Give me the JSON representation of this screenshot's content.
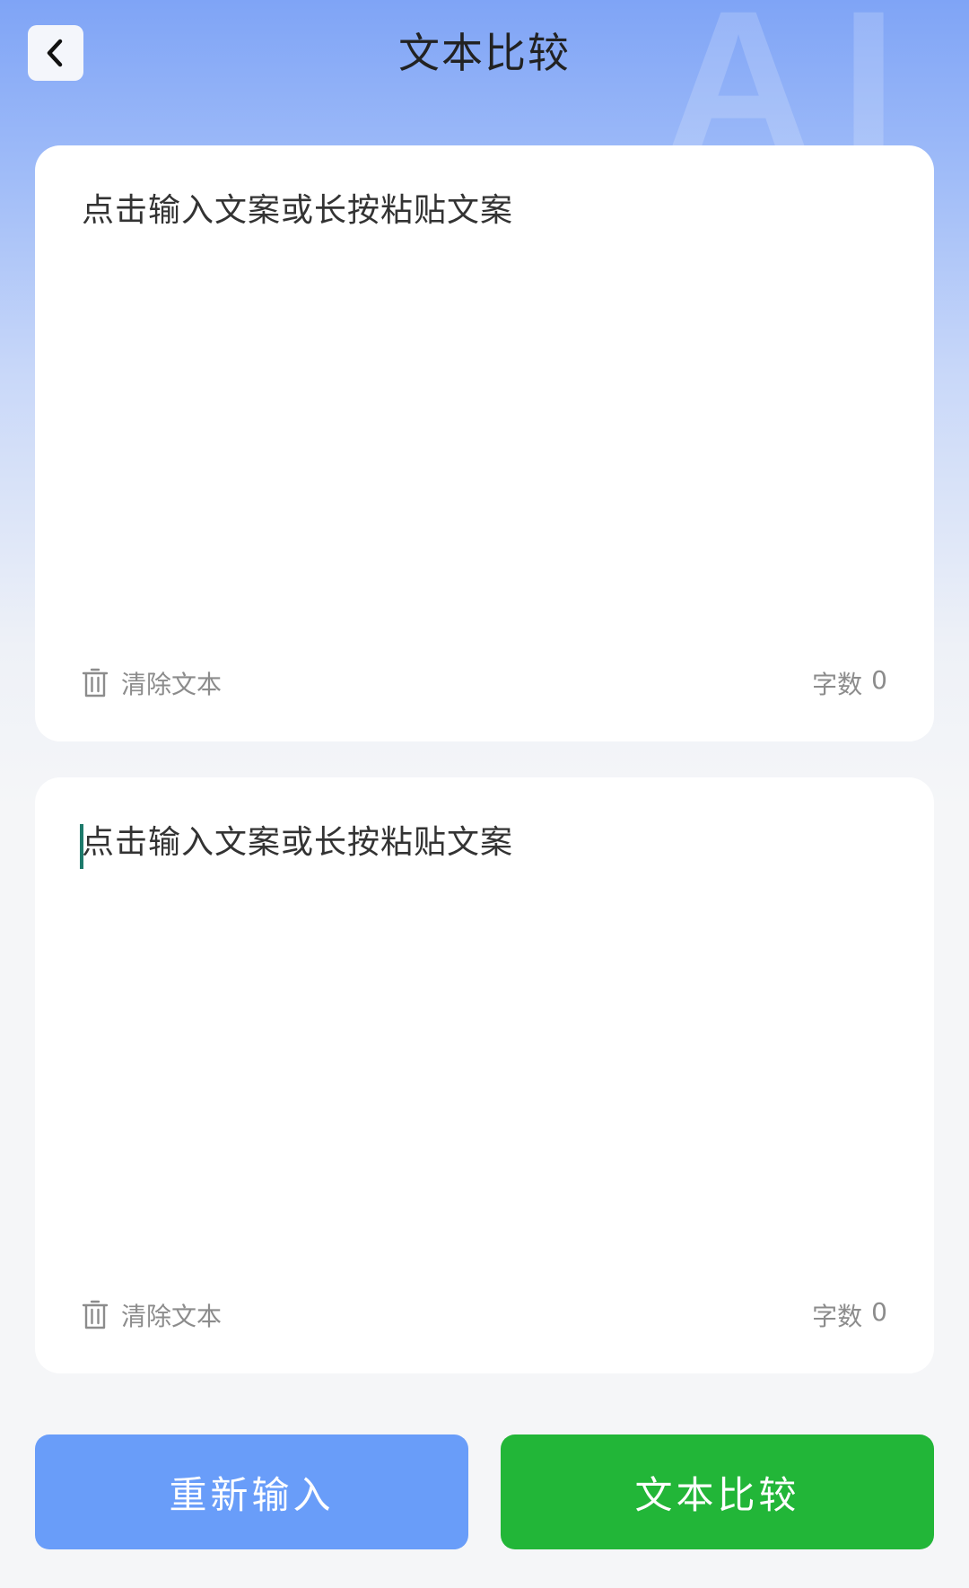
{
  "header": {
    "title": "文本比较",
    "watermark": "AI"
  },
  "cards": [
    {
      "placeholder": "点击输入文案或长按粘贴文案",
      "value": "",
      "clear_label": "清除文本",
      "count_label": "字数",
      "count_value": "0"
    },
    {
      "placeholder": "点击输入文案或长按粘贴文案",
      "value": "",
      "clear_label": "清除文本",
      "count_label": "字数",
      "count_value": "0"
    }
  ],
  "actions": {
    "reset_label": "重新输入",
    "compare_label": "文本比较"
  },
  "colors": {
    "reset_button": "#699df9",
    "compare_button": "#22b638",
    "caret": "#1d7a6b"
  }
}
